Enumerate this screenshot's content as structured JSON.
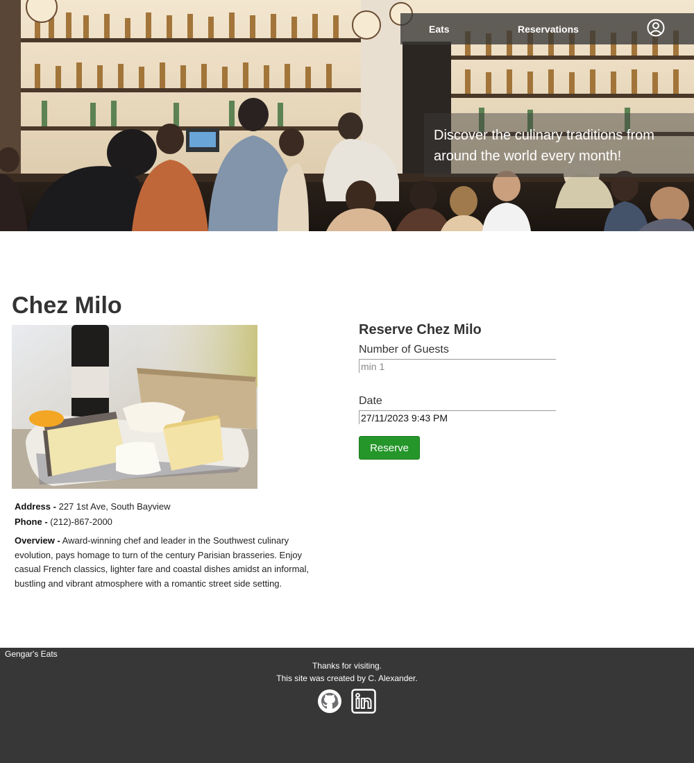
{
  "nav": {
    "eats_label": "Eats",
    "reservations_label": "Reservations",
    "user_icon": "user-circle-icon"
  },
  "hero": {
    "tagline": "Discover the culinary traditions from around the world every month!"
  },
  "restaurant": {
    "name": "Chez Milo",
    "address_label": "Address -",
    "address": "227 1st Ave, South Bayview",
    "phone_label": "Phone -",
    "phone": "(212)-867-2000",
    "overview_label": "Overview -",
    "overview": "Award-winning chef and leader in the Southwest culinary evolution, pays homage to turn of the century Parisian brasseries. Enjoy casual French classics, lighter fare and coastal dishes amidst an informal, bustling and vibrant atmosphere with a romantic street side setting."
  },
  "reservation": {
    "heading": "Reserve Chez Milo",
    "guests_label": "Number of Guests",
    "guests_placeholder": "min 1",
    "date_label": "Date",
    "date_value": "27/11/2023 9:43 PM",
    "button_label": "Reserve",
    "button_color": "#25962a"
  },
  "footer": {
    "brand": "Gengar's Eats",
    "thanks": "Thanks for visiting.",
    "credit": "This site was created by C. Alexander.",
    "github_icon": "github-icon",
    "linkedin_icon": "linkedin-icon"
  }
}
